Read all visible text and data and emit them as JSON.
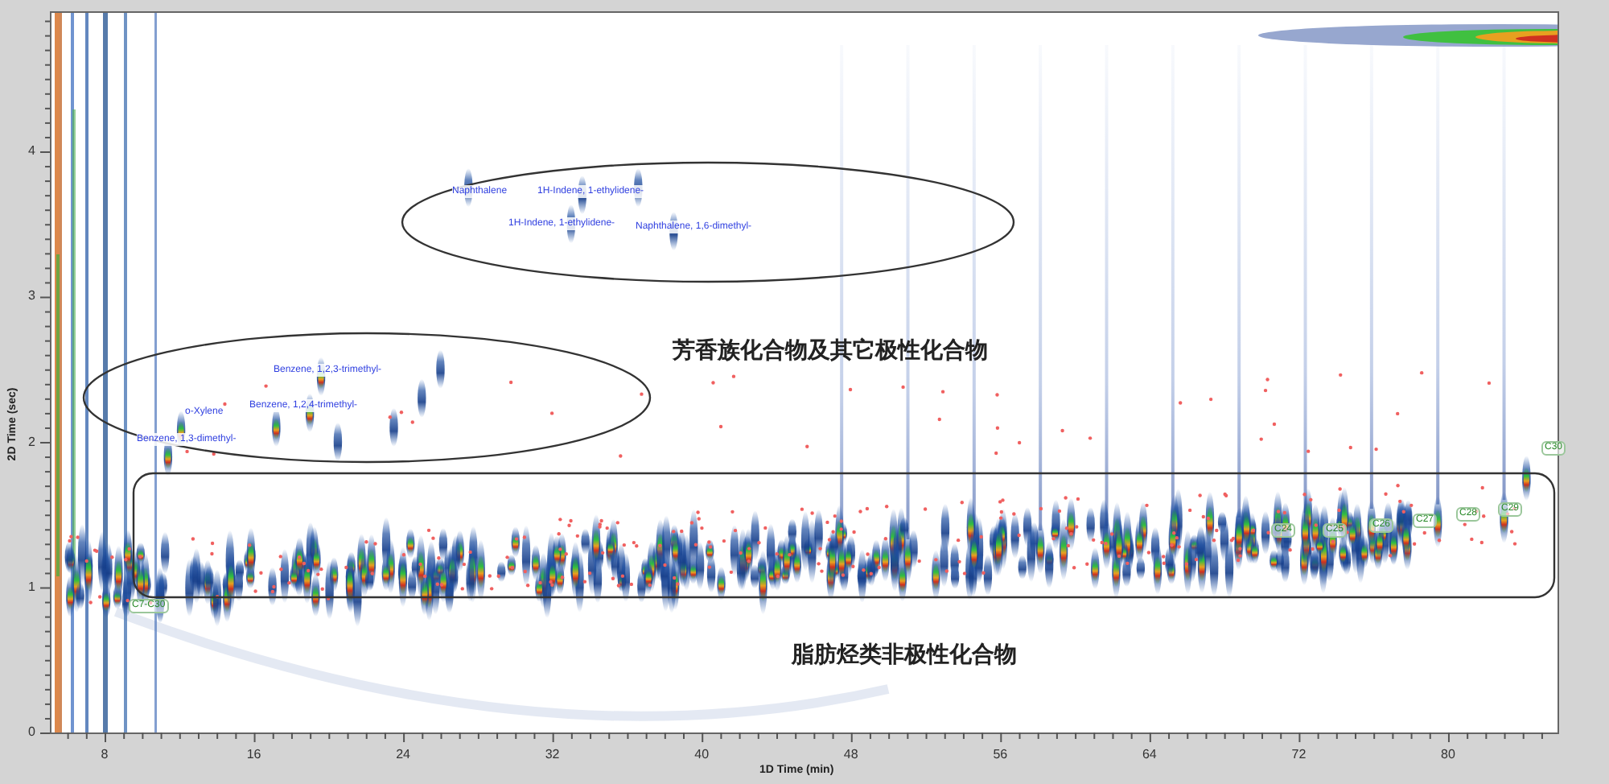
{
  "plot": {
    "compound_labels": [
      "Naphthalene",
      "1H-Indene, 1-ethylidene-",
      "1H-Indene, 1-ethylidene-",
      "Naphthalene, 1,6-dimethyl-",
      "Benzene, 1,2,3-trimethyl-",
      "Benzene, 1,2,4-trimethyl-",
      "o-Xylene",
      "Benzene, 1,3-dimethyl-"
    ],
    "carbon_labels": [
      "C7-C30",
      "C24",
      "C25",
      "C26",
      "C27",
      "C28",
      "C29",
      "C30"
    ],
    "annotations": [
      {
        "kind": "ellipse"
      },
      {
        "kind": "ellipse"
      },
      {
        "kind": "rounded-rect"
      }
    ],
    "region_labels": [
      "芳香族化合物及其它极性化合物",
      "脂肪烃类非极性化合物"
    ]
  },
  "y_axis": {
    "title": "2D Time (sec)",
    "ticks": [
      "4",
      "3",
      "2",
      "1",
      "0"
    ]
  },
  "x_axis": {
    "title": "1D Time (min)",
    "ticks": [
      "8",
      "16",
      "24",
      "32",
      "40",
      "48",
      "56",
      "64",
      "72",
      "80"
    ]
  }
}
